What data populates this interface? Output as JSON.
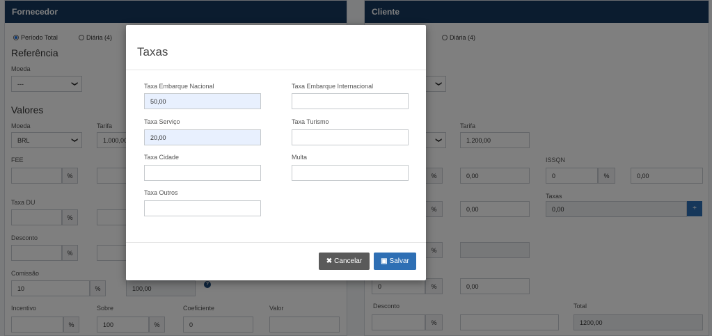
{
  "fornecedor": {
    "title": "Fornecedor",
    "radio_periodo": "Período Total",
    "radio_diaria": "Diária (4)",
    "referencia": "Referência",
    "moeda_label": "Moeda",
    "moeda_ref_value": "---",
    "valores": "Valores",
    "valores_moeda_label": "Moeda",
    "valores_moeda_value": "BRL",
    "tarifa_label": "Tarifa",
    "tarifa_value": "1.000,00",
    "fee_label": "FEE",
    "percent": "%",
    "taxa_du_label": "Taxa DU",
    "desconto_label": "Desconto",
    "comissao_label": "Comissão",
    "comissao_value": "10",
    "comissao_total": "100,00",
    "incentivo_label": "Incentivo",
    "sobre_label": "Sobre",
    "sobre_value": "100",
    "coeficiente_label": "Coeficiente",
    "coeficiente_value": "0",
    "valor_label": "Valor"
  },
  "cliente": {
    "title": "Cliente",
    "radio_diaria": "Diária (4)",
    "tarifa_label": "Tarifa",
    "tarifa_value": "1.200,00",
    "issqn_label": "ISSQN",
    "issqn_value": "0",
    "issqn_total": "0,00",
    "fee_total": "0,00",
    "taxas_label": "Taxas",
    "taxas_value": "0,00",
    "taxa_du_total": "0,00",
    "comissao_value": "0",
    "comissao_total": "0,00",
    "desconto_label": "Desconto",
    "total_label": "Total",
    "total_value": "1200,00",
    "percent": "%",
    "plus": "+"
  },
  "modal": {
    "title": "Taxas",
    "taxa_embarque_nacional_label": "Taxa Embarque Nacional",
    "taxa_embarque_nacional_value": "50,00",
    "taxa_embarque_internacional_label": "Taxa Embarque Internacional",
    "taxa_embarque_internacional_value": "",
    "taxa_servico_label": "Taxa Serviço",
    "taxa_servico_value": "20,00",
    "taxa_turismo_label": "Taxa Turismo",
    "taxa_turismo_value": "",
    "taxa_cidade_label": "Taxa Cidade",
    "taxa_cidade_value": "",
    "multa_label": "Multa",
    "multa_value": "",
    "taxa_outros_label": "Taxa Outros",
    "taxa_outros_value": "",
    "cancel_label": "Cancelar",
    "save_label": "Salvar"
  },
  "colors": {
    "panel_header": "#16385f",
    "save_button": "#2e6fb4",
    "cancel_button": "#5a5a5a",
    "filled_input": "#e8f0fe"
  }
}
